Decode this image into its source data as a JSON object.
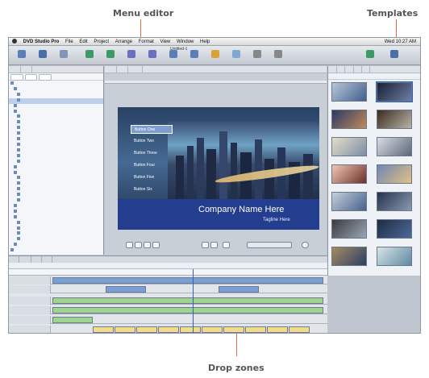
{
  "callouts": {
    "menu_editor": "Menu editor",
    "templates": "Templates",
    "drop_zones": "Drop zones"
  },
  "menubar": {
    "app": "DVD Studio Pro",
    "items": [
      "File",
      "Edit",
      "Project",
      "Arrange",
      "Format",
      "View",
      "Window",
      "Help"
    ],
    "clock": "Wed 10:27 AM"
  },
  "window_title": "Untitled-1",
  "menu_buttons": [
    "Button One",
    "Button Two",
    "Button Three",
    "Button Four",
    "Button Five",
    "Button Six"
  ],
  "canvas": {
    "company": "Company Name Here",
    "subtitle": "Tagline Here"
  },
  "colors": {
    "callout_line": "#e46b4f",
    "active_button": "#7f9ed0",
    "title_band": "#243e8f"
  }
}
